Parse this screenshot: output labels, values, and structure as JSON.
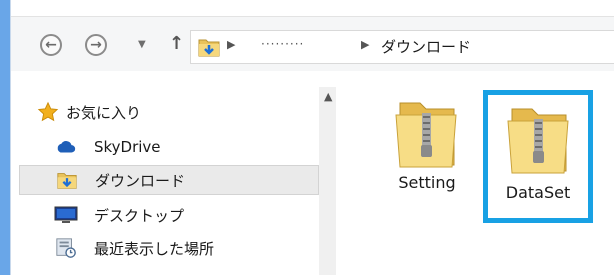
{
  "window": {
    "accent_color": "#18a1e4",
    "frame_color": "#69a6e8"
  },
  "toolbar": {
    "back_icon": "back-arrow-icon",
    "forward_icon": "forward-arrow-icon",
    "recent_icon": "chevron-down-icon",
    "up_icon": "up-arrow-icon"
  },
  "address": {
    "dots": "·········",
    "current": "ダウンロード"
  },
  "sidebar": {
    "items": [
      {
        "label": "お気に入り",
        "icon": "star-icon"
      },
      {
        "label": "SkyDrive",
        "icon": "cloud-icon"
      },
      {
        "label": "ダウンロード",
        "icon": "downloads-folder-icon",
        "selected": true
      },
      {
        "label": "デスクトップ",
        "icon": "desktop-icon"
      },
      {
        "label": "最近表示した場所",
        "icon": "recent-places-icon"
      }
    ]
  },
  "files": [
    {
      "name": "Setting",
      "icon": "zip-folder-icon"
    },
    {
      "name": "DataSet",
      "icon": "zip-folder-icon",
      "selected": true
    }
  ]
}
